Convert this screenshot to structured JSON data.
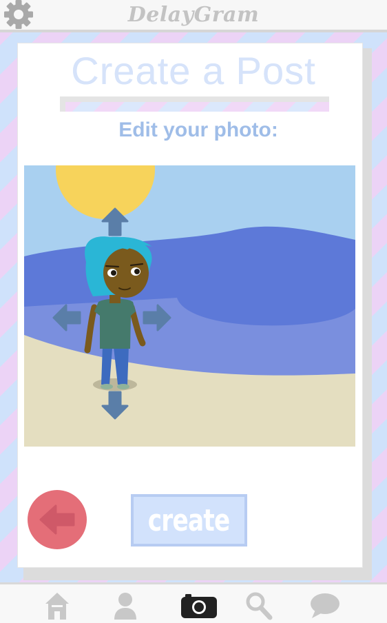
{
  "app": {
    "brand": "DelayGram"
  },
  "page": {
    "title": "Create a Post",
    "subtitle": "Edit your photo:"
  },
  "actions": {
    "create_label": "create"
  },
  "icons": {
    "settings": "gear-icon",
    "back": "back-arrow-icon",
    "move_up": "arrow-up-icon",
    "move_down": "arrow-down-icon",
    "move_left": "arrow-left-icon",
    "move_right": "arrow-right-icon"
  },
  "nav": [
    {
      "name": "home",
      "icon": "home-icon"
    },
    {
      "name": "profile",
      "icon": "user-icon"
    },
    {
      "name": "camera",
      "icon": "camera-icon",
      "active": true
    },
    {
      "name": "search",
      "icon": "search-icon"
    },
    {
      "name": "messages",
      "icon": "chat-icon"
    }
  ],
  "colors": {
    "sky": "#a9d0f0",
    "sun": "#f7d35b",
    "sea_dark": "#5d79d8",
    "sea_light": "#7a8fde",
    "sand": "#e4dec0",
    "arrow": "#5a7ea8",
    "back_button": "#e46e78",
    "create_button": "#d2e2fc",
    "nav_icon": "#c8c8c8",
    "nav_icon_active": "#222222"
  }
}
